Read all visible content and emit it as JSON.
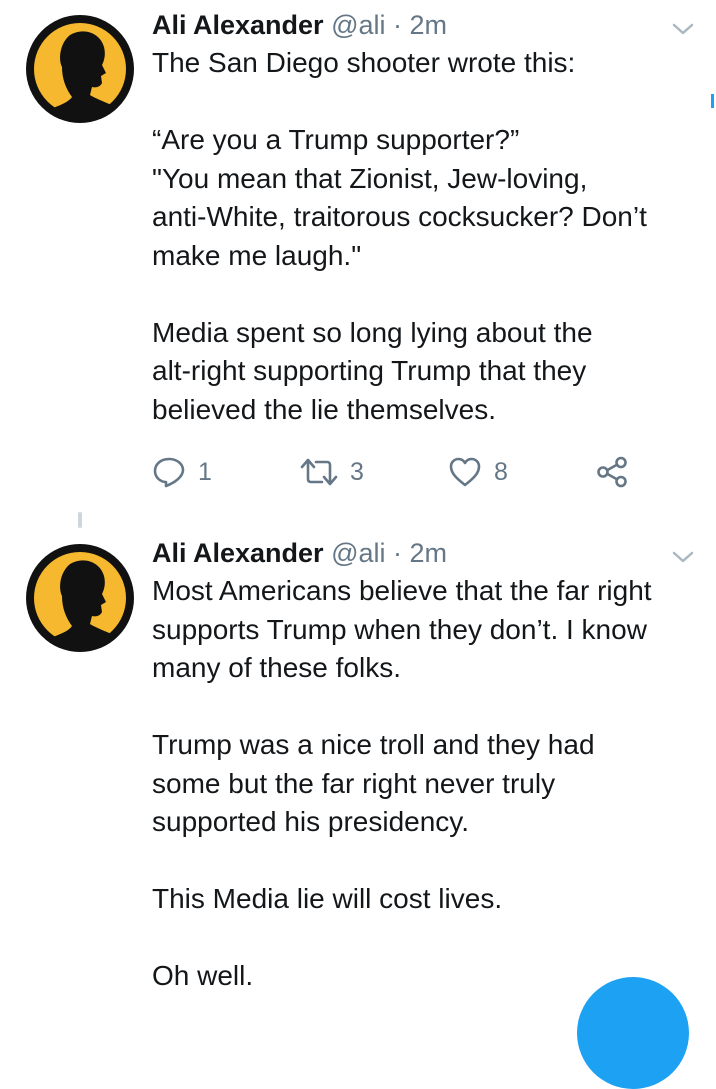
{
  "tweets": [
    {
      "author_name": "Ali Alexander",
      "handle": "@ali",
      "separator": "·",
      "time": "2m",
      "lines": [
        "The San Diego shooter wrote this:",
        "",
        "“Are you a Trump supporter?”",
        "\"You mean that Zionist, Jew-loving,",
        "anti-White, traitorous cocksucker? Don’t",
        "make me laugh.\"",
        "",
        "Media spent so long lying about the",
        "alt-right supporting Trump that they",
        "believed the lie themselves."
      ],
      "reply_count": "1",
      "retweet_count": "3",
      "like_count": "8"
    },
    {
      "author_name": "Ali Alexander",
      "handle": "@ali",
      "separator": "·",
      "time": "2m",
      "lines": [
        "Most Americans believe that the far right",
        "supports Trump when they don’t. I know",
        "many of these folks.",
        "",
        "Trump was a nice troll and they had",
        "some but the far right never truly",
        "supported his presidency.",
        "",
        "This Media lie will cost lives.",
        "",
        "Oh well."
      ]
    }
  ],
  "icons": {
    "avatar": "silhouette-avatar-icon",
    "caret": "chevron-down-icon",
    "reply": "reply-icon",
    "retweet": "retweet-icon",
    "like": "heart-icon",
    "share": "share-icon"
  },
  "colors": {
    "avatar_background": "#f5b82e",
    "avatar_silhouette": "#111111",
    "accent": "#1da1f2",
    "secondary_text": "#657786",
    "primary_text": "#14171a"
  }
}
